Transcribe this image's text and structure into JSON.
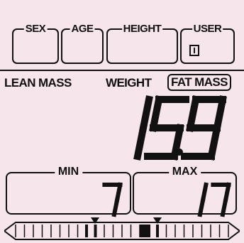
{
  "settings": {
    "sex_label": "SEX",
    "age_label": "AGE",
    "height_label": "HEIGHT",
    "user_label": "USER",
    "user_value": "1"
  },
  "modes": {
    "lean": "LEAN MASS",
    "weight": "WEIGHT",
    "fat": "FAT MASS",
    "selected": "FAT MASS"
  },
  "reading": {
    "value": "15.9"
  },
  "range": {
    "min_label": "MIN",
    "min_value": "7",
    "max_label": "MAX",
    "max_value": "17"
  },
  "scale": {
    "segments": 24,
    "highlighted_segment": 14,
    "marker_segments": [
      8,
      9,
      16
    ]
  }
}
